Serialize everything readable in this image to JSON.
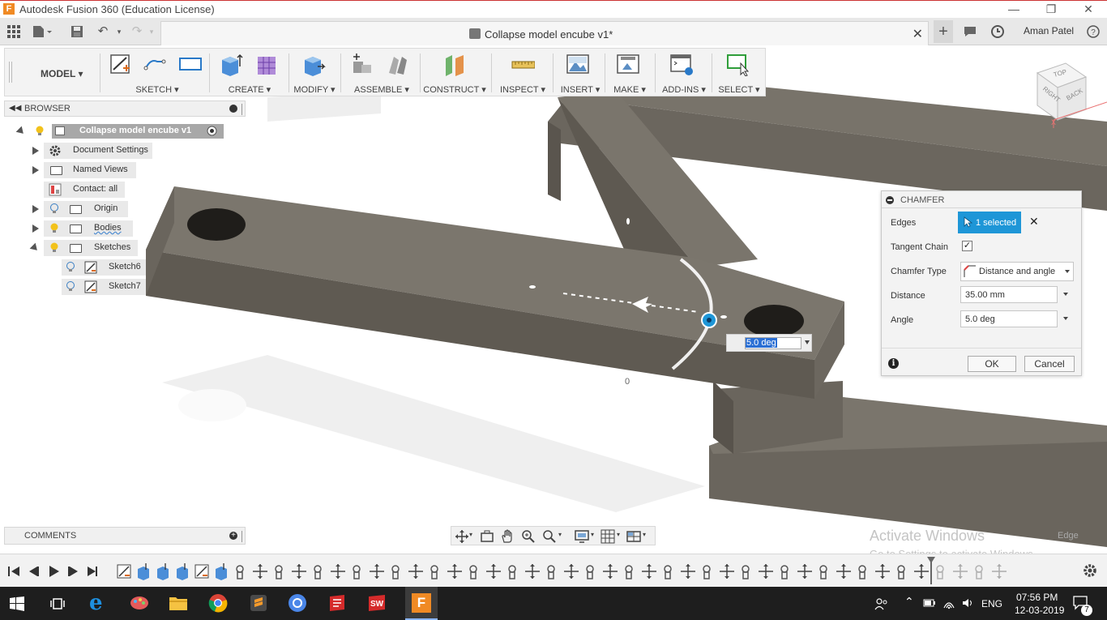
{
  "window": {
    "title": "Autodesk Fusion 360 (Education License)",
    "app_icon_letter": "F"
  },
  "appbar": {
    "document_title": "Collapse model encube v1*",
    "user_name": "Aman Patel"
  },
  "toolbar": {
    "workspace": "MODEL",
    "groups": [
      "SKETCH",
      "CREATE",
      "MODIFY",
      "ASSEMBLE",
      "CONSTRUCT",
      "INSPECT",
      "INSERT",
      "MAKE",
      "ADD-INS",
      "SELECT"
    ]
  },
  "browser": {
    "title": "BROWSER",
    "root": "Collapse model encube v1",
    "items": [
      {
        "label": "Document Settings"
      },
      {
        "label": "Named Views"
      },
      {
        "label": "Contact: all"
      },
      {
        "label": "Origin"
      },
      {
        "label": "Bodies"
      },
      {
        "label": "Sketches"
      },
      {
        "label": "Sketch6"
      },
      {
        "label": "Sketch7"
      }
    ]
  },
  "comments": {
    "title": "COMMENTS"
  },
  "chamfer": {
    "title": "CHAMFER",
    "edges_label": "Edges",
    "edges_value": "1 selected",
    "tangent_chain_label": "Tangent Chain",
    "tangent_chain_checked": true,
    "chamfer_type_label": "Chamfer Type",
    "chamfer_type_value": "Distance and angle",
    "distance_label": "Distance",
    "distance_value": "35.00 mm",
    "angle_label": "Angle",
    "angle_value": "5.0 deg",
    "ok_label": "OK",
    "cancel_label": "Cancel"
  },
  "canvas": {
    "angle_input_value": "5.0 deg",
    "small_label": "0",
    "viewcube_faces": [
      "TOP",
      "RIGHT",
      "BACK"
    ],
    "status_edge": "Edge"
  },
  "watermark": {
    "line1": "Activate Windows",
    "line2": "Go to Settings to activate Windows."
  },
  "taskbar": {
    "language": "ENG",
    "time": "07:56 PM",
    "date": "12-03-2019",
    "notification_count": "7"
  },
  "colors": {
    "accent": "#1e96d7",
    "model_body": "#6a655d",
    "model_top": "#7b766d",
    "timeline_bg": "#f2f2f2"
  }
}
